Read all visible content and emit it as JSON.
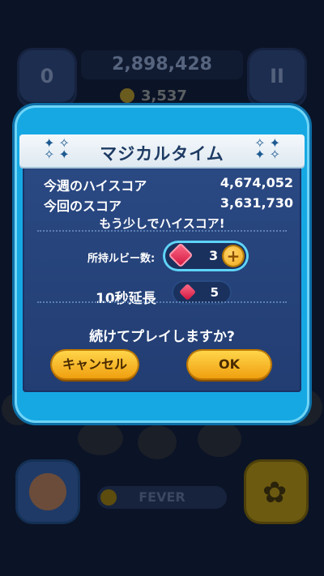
{
  "background": {
    "score": "2,898,428",
    "coins": "3,537",
    "left_button": "0",
    "right_button": "II",
    "fever_label": "FEVER"
  },
  "dialog": {
    "title": "マジカルタイム",
    "high_score_label": "今週のハイスコア",
    "high_score_value": "4,674,052",
    "current_score_label": "今回のスコア",
    "current_score_value": "3,631,730",
    "message": "もう少しでハイスコア!",
    "ruby_label": "所持ルビー数:",
    "ruby_count": "3",
    "extend_label": "10秒延長",
    "extend_cost": "5",
    "question": "続けてプレイしますか?",
    "cancel_label": "キャンセル",
    "ok_label": "OK"
  },
  "colors": {
    "dialog_frame": "#16a8e3",
    "dialog_body": "#2b4a85",
    "button_yellow": "#ffd54a",
    "ruby_red": "#d0123a"
  }
}
